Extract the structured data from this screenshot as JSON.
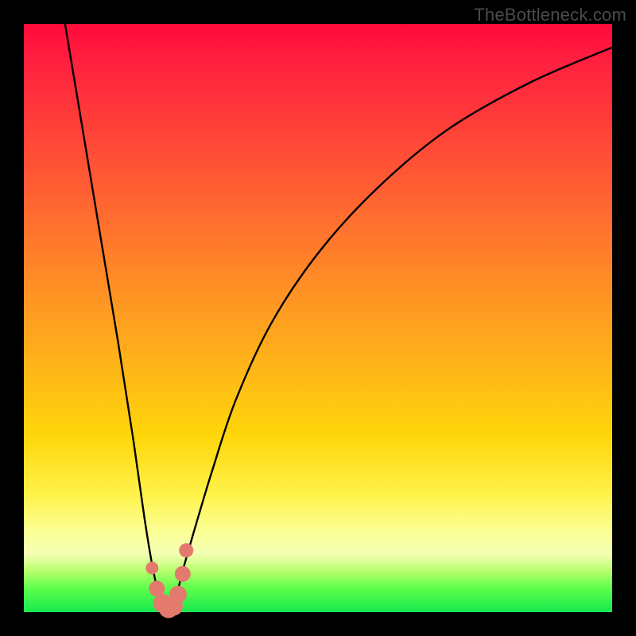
{
  "watermark": "TheBottleneck.com",
  "chart_data": {
    "type": "line",
    "title": "",
    "xlabel": "",
    "ylabel": "",
    "xlim": [
      0,
      100
    ],
    "ylim": [
      0,
      100
    ],
    "series": [
      {
        "name": "bottleneck-curve",
        "x": [
          7,
          10,
          13,
          16,
          18.5,
          20.5,
          22,
          23,
          24,
          25,
          26,
          27,
          29,
          32,
          36,
          42,
          50,
          60,
          72,
          86,
          100
        ],
        "values": [
          100,
          82,
          64,
          46,
          30,
          16,
          7,
          3,
          0,
          0,
          3,
          7,
          14,
          24,
          36,
          49,
          61,
          72,
          82,
          90,
          96
        ]
      }
    ],
    "markers": {
      "name": "highlight-points",
      "color_hex": "#e27a6e",
      "x": [
        21.8,
        22.6,
        23.6,
        24.4,
        24.6,
        25.4,
        26.2,
        27.0,
        27.6
      ],
      "values": [
        7.5,
        4.0,
        1.5,
        0.6,
        0.6,
        1.0,
        3.0,
        6.5,
        10.5
      ],
      "radius": [
        8,
        10,
        12,
        11,
        12,
        12,
        11,
        10,
        9
      ]
    },
    "gradient_stops": [
      {
        "pos": 0,
        "color": "#ff0a3a"
      },
      {
        "pos": 50,
        "color": "#ff9324"
      },
      {
        "pos": 80,
        "color": "#fff24a"
      },
      {
        "pos": 100,
        "color": "#17e84e"
      }
    ]
  }
}
